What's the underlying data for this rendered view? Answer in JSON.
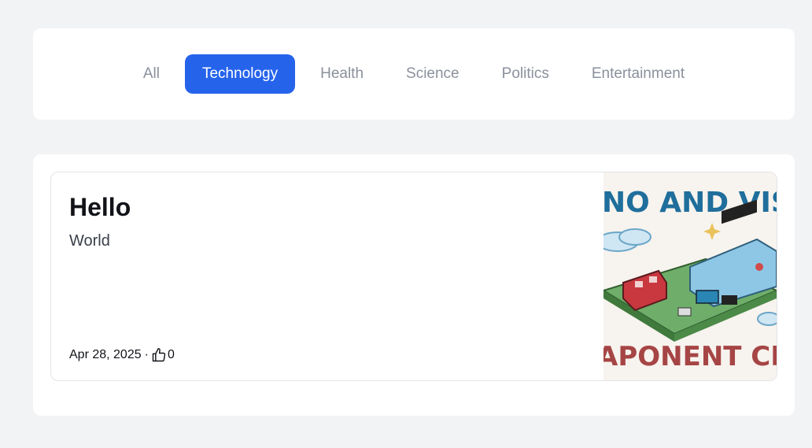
{
  "tabs": [
    {
      "label": "All",
      "active": false
    },
    {
      "label": "Technology",
      "active": true
    },
    {
      "label": "Health",
      "active": false
    },
    {
      "label": "Science",
      "active": false
    },
    {
      "label": "Politics",
      "active": false
    },
    {
      "label": "Entertainment",
      "active": false
    }
  ],
  "post": {
    "title": "Hello",
    "subtitle": "World",
    "date": "Apr 28, 2025",
    "separator": "·",
    "likes": "0",
    "image_text_top": "NO AND VISU",
    "image_text_bottom": "APONENT CREATI"
  },
  "colors": {
    "accent": "#2563eb",
    "background": "#f2f3f5"
  }
}
